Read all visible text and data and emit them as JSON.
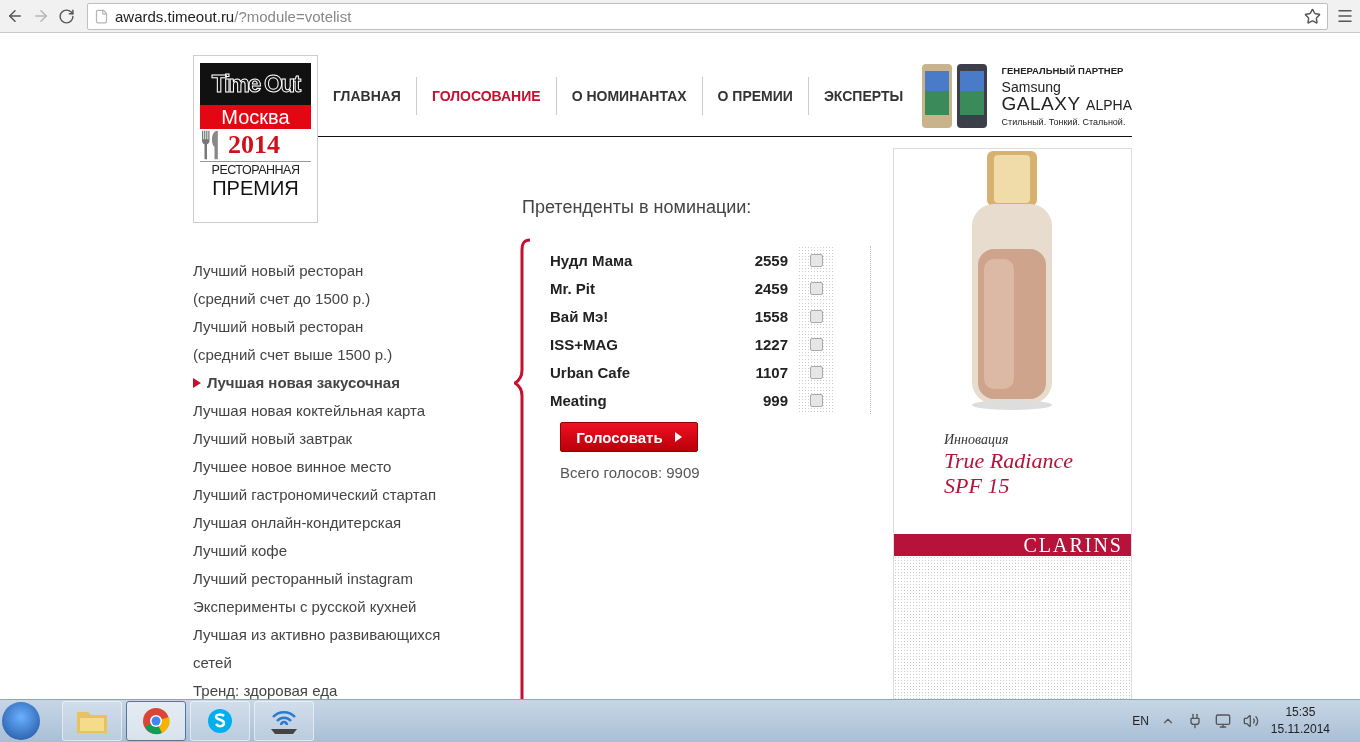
{
  "browser": {
    "url_host": "awards.timeout.ru",
    "url_path": "/?module=votelist"
  },
  "logo": {
    "brand": "Time Out",
    "city": "Москва",
    "year": "2014",
    "line1": "РЕСТОРАННАЯ",
    "line2": "ПРЕМИЯ"
  },
  "nav": [
    {
      "label": "ГЛАВНАЯ",
      "selected": false
    },
    {
      "label": "ГОЛОСОВАНИЕ",
      "selected": true
    },
    {
      "label": "О НОМИНАНТАХ",
      "selected": false
    },
    {
      "label": "О ПРЕМИИ",
      "selected": false
    },
    {
      "label": "ЭКСПЕРТЫ",
      "selected": false
    }
  ],
  "partner": {
    "caption": "ГЕНЕРАЛЬНЫЙ ПАРТНЕР",
    "brand": "Samsung",
    "model": "GALAXY",
    "variant": "ALPHA",
    "slogan": "Стильный. Тонкий. Стальной."
  },
  "categories": [
    {
      "label": "Лучший новый ресторан",
      "note": "(средний счет до 1500 р.)",
      "selected": false
    },
    {
      "label": "Лучший новый ресторан",
      "note": "(средний счет выше 1500 р.)",
      "selected": false
    },
    {
      "label": "Лучшая новая закусочная",
      "selected": true
    },
    {
      "label": "Лучшая новая коктейльная карта",
      "selected": false
    },
    {
      "label": "Лучший новый завтрак",
      "selected": false
    },
    {
      "label": "Лучшее новое винное место",
      "selected": false
    },
    {
      "label": "Лучший гастрономический стартап",
      "selected": false
    },
    {
      "label": "Лучшая онлайн-кондитерская",
      "selected": false
    },
    {
      "label": "Лучший кофе",
      "selected": false
    },
    {
      "label": "Лучший ресторанный instagram",
      "selected": false
    },
    {
      "label": "Эксперименты с русской кухней",
      "selected": false
    },
    {
      "label": "Лучшая из активно развивающихся",
      "note": "сетей",
      "selected": false
    },
    {
      "label": "Тренд: здоровая еда",
      "selected": false
    }
  ],
  "vote": {
    "heading": "Претенденты в номинации:",
    "nominees": [
      {
        "name": "Нудл Мама",
        "votes": "2559",
        "checked": false
      },
      {
        "name": "Mr. Pit",
        "votes": "2459",
        "checked": false
      },
      {
        "name": "Вай Мэ!",
        "votes": "1558",
        "checked": false
      },
      {
        "name": "ISS+MAG",
        "votes": "1227",
        "checked": false
      },
      {
        "name": "Urban Cafe",
        "votes": "1107",
        "checked": false
      },
      {
        "name": "Meating",
        "votes": "999",
        "checked": false
      }
    ],
    "button": "Голосовать",
    "total": "Всего голосов: 9909"
  },
  "ad": {
    "kicker": "Инновация",
    "title": "True Radiance",
    "subtitle": "SPF 15",
    "brand": "CLARINS"
  },
  "taskbar": {
    "apps": [
      {
        "kind": "explorer",
        "selected": false
      },
      {
        "kind": "chrome",
        "selected": true
      },
      {
        "kind": "skype",
        "selected": false
      },
      {
        "kind": "network",
        "selected": false
      }
    ],
    "language": "EN",
    "time": "15:35",
    "date": "15.11.2014"
  }
}
